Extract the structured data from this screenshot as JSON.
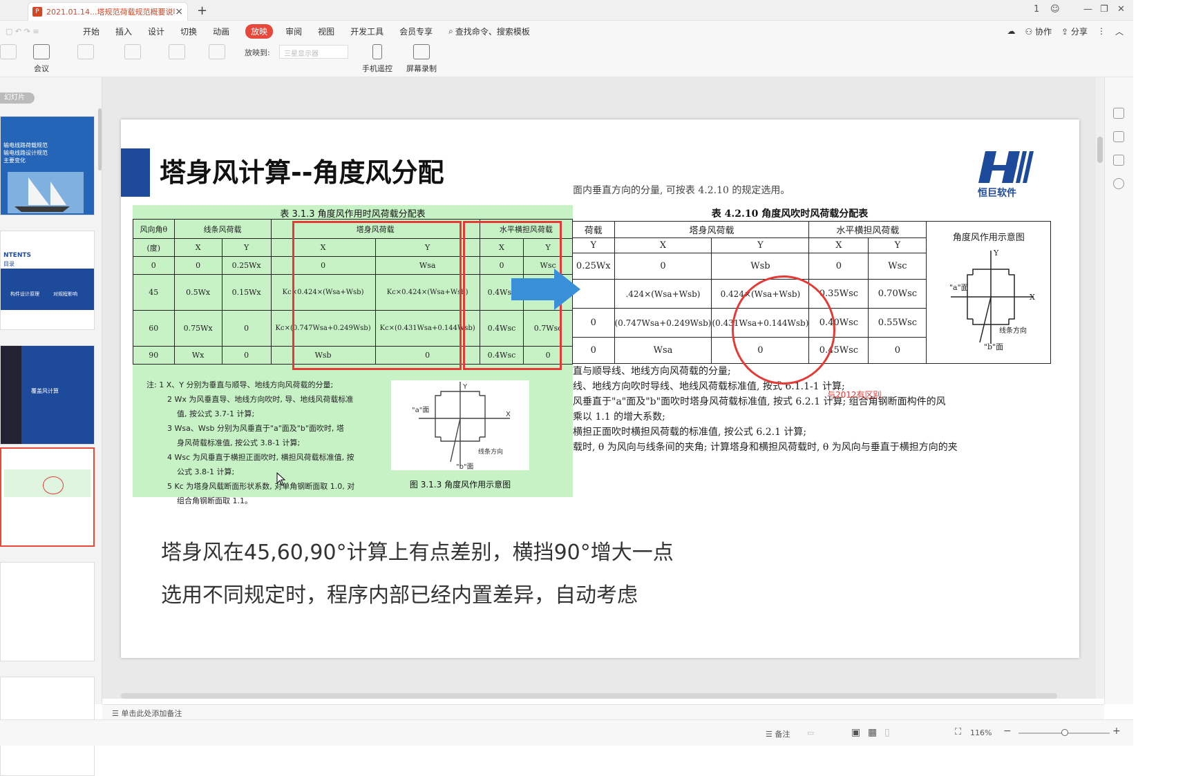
{
  "window": {
    "tab_title": "2021.01.14...塔规范荷载规范概要说明",
    "tab_icon": "ppt-file-icon",
    "new_tab": "+",
    "controls": [
      "1",
      "—",
      "❐",
      "✕"
    ]
  },
  "menu": {
    "items": [
      "开始",
      "插入",
      "设计",
      "切换",
      "动画",
      "放映",
      "审阅",
      "视图",
      "开发工具",
      "会员专享"
    ],
    "active": "放映",
    "search": "查找命令、搜索模板",
    "right": [
      "协作",
      "分享"
    ]
  },
  "ribbon": {
    "meeting": "会议",
    "play_to_label": "放映到:",
    "play_to_value": "三星显示器",
    "phone_remote": "手机遥控",
    "screen_record": "屏幕录制"
  },
  "sidebar": {
    "label": "幻灯片",
    "thumbs": [
      {
        "lines": [
          "输电线路荷载规范",
          "输电线路设计规范",
          "主要变化"
        ]
      },
      {
        "lines": [
          "NTENTS",
          "目录",
          "构件设计原理",
          "对规程影响"
        ]
      },
      {
        "lines": [
          "覆盖风计算"
        ]
      },
      {
        "lines": []
      },
      {
        "lines": []
      },
      {
        "lines": []
      }
    ]
  },
  "slide": {
    "title": "塔身风计算--角度风分配",
    "logo_text": "恒巨软件",
    "table1": {
      "caption": "表 3.1.3  角度风作用时风荷载分配表",
      "head1": [
        "风向角θ",
        "线条风荷载",
        "塔身风荷载",
        "水平横担风荷载"
      ],
      "head2": [
        "(度)",
        "X",
        "Y",
        "X",
        "Y",
        "X",
        "Y"
      ],
      "rows": [
        [
          "0",
          "0",
          "0.25Wx",
          "0",
          "Wsa",
          "0",
          "Wsc"
        ],
        [
          "45",
          "0.5Wx",
          "0.15Wx",
          "Kc×0.424×(Wsa+Wsb)",
          "Kc×0.424×(Wsa+Wsb)",
          "0.4Wsc",
          "0.7Wsc"
        ],
        [
          "60",
          "0.75Wx",
          "0",
          "Kc×(0.747Wsa+0.249Wsb)",
          "Kc×(0.431Wsa+0.144Wsb)",
          "0.4Wsc",
          "0.7Wsc"
        ],
        [
          "90",
          "Wx",
          "0",
          "Wsb",
          "0",
          "0.4Wsc",
          "0"
        ]
      ]
    },
    "notes": [
      "注: 1  X、Y 分别为垂直与顺导、地线方向风荷载的分量;",
      "2  Wx 为风垂直导、地线方向吹时, 导、地线风荷载标准",
      "值, 按公式 3.7-1 计算;",
      "3  Wsa、Wsb 分别为风垂直于\"a\"面及\"b\"面吹时, 塔",
      "身风荷载标准值, 按公式 3.8-1 计算;",
      "4  Wsc 为风垂直于横担正面吹时, 横担风荷载标准值, 按",
      "公式 3.8-1 计算;",
      "5  Kc 为塔身风载断面形状系数, 对单角钢断面取 1.0, 对",
      "组合角钢断面取 1.1。"
    ],
    "diagram1": {
      "caption": "图 3.1.3  角度风作用示意图",
      "labels": [
        "\"a\"面",
        "\"b\"面",
        "线条方向",
        "X",
        "Y"
      ]
    },
    "doc_top_text": "面内垂直方向的分量, 可按表 4.2.10 的规定选用。",
    "table2": {
      "caption": "表 4.2.10  角度风吹时风荷载分配表",
      "head1": [
        "荷载",
        "塔身风荷载",
        "水平横担风荷载",
        "角度风作用示意图"
      ],
      "head2": [
        "Y",
        "X",
        "Y",
        "X",
        "Y"
      ],
      "rows": [
        [
          "0.25Wx",
          "0",
          "Wsb",
          "0",
          "Wsc"
        ],
        [
          "",
          ".424×(Wsa+Wsb)",
          "0.424×(Wsa+Wsb)",
          "0.35Wsc",
          "0.70Wsc"
        ],
        [
          "0",
          "(0.747Wsa+0.249Wsb)",
          "(0.431Wsa+0.144Wsb)",
          "0.40Wsc",
          "0.55Wsc"
        ],
        [
          "0",
          "Wsa",
          "0",
          "0.45Wsc",
          "0"
        ]
      ]
    },
    "diagram2_labels": [
      "\"a\"面",
      "\"b\"面",
      "线条方向",
      "X",
      "Y"
    ],
    "circle_label": "与2012有区别",
    "doc_lines": [
      "直与顺导线、地线方向风荷载的分量;",
      "线、地线方向吹时导线、地线风荷载标准值, 按式 6.1.1-1 计算;",
      "风垂直于\"a\"面及\"b\"面吹时塔身风荷载标准值, 按式 6.2.1 计算; 组合角钢断面构件的风",
      "乘以 1.1 的增大系数;",
      "横担正面吹时横担风荷载的标准值, 按公式 6.2.1 计算;",
      "载时, θ 为风向与线条间的夹角; 计算塔身和横担风荷载时, θ 为风向与垂直于横担方向的夹"
    ],
    "summary": [
      "塔身风在45,60,90°计算上有点差别，横挡90°增大一点",
      "选用不同规定时，程序内部已经内置差异，自动考虑"
    ]
  },
  "notes_bar": "单击此处添加备注",
  "status": {
    "notes": "备注",
    "zoom": "116%"
  },
  "colors": {
    "accent": "#e8473c",
    "brand_blue": "#1e4a9c",
    "highlight_green": "#c6f2c6",
    "arrow_blue": "#3a8fd9"
  }
}
